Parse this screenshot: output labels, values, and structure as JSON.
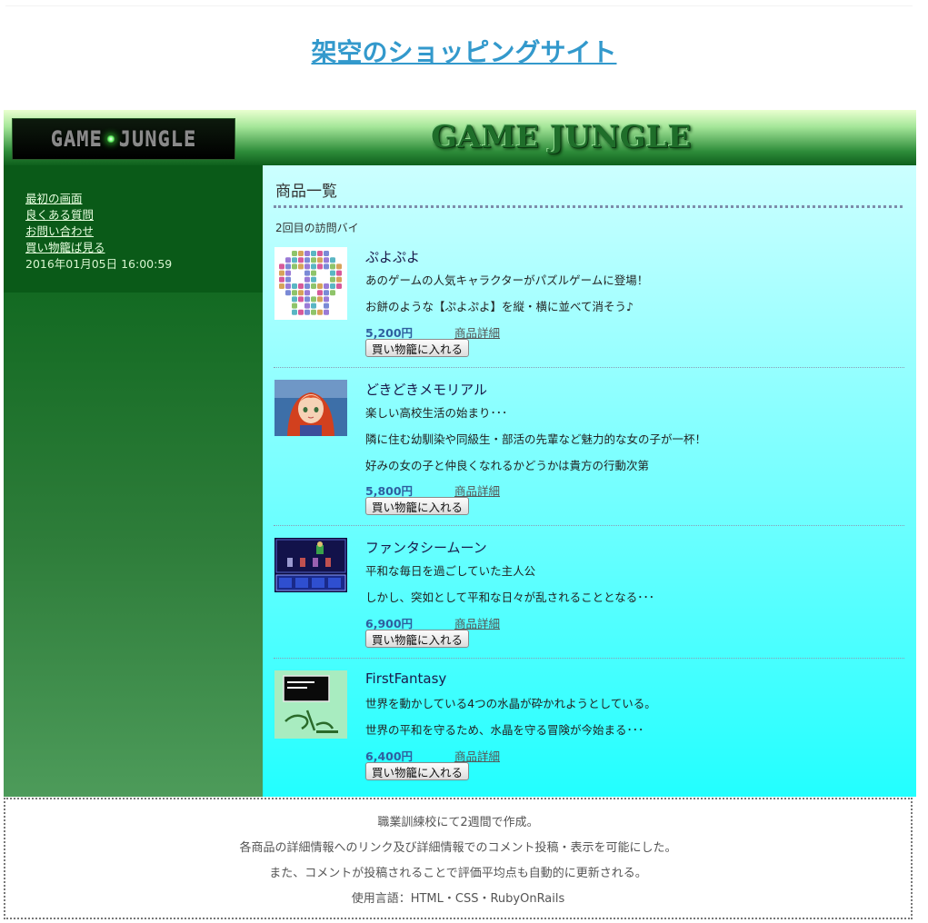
{
  "site_title": "架空のショッピングサイト",
  "header": {
    "logo_text": "GAME",
    "logo_text2": "JUNGLE",
    "banner_title": "GAME JUNGLE"
  },
  "sidebar": {
    "links": [
      "最初の画面",
      "良くある質問",
      "お問い合わせ",
      "買い物籠ば見る"
    ],
    "timestamp": "2016年01月05日 16:00:59"
  },
  "main": {
    "title": "商品一覧",
    "visit_text": "2回目の訪問バイ",
    "detail_label": "商品詳細",
    "cart_button_label": "買い物籠に入れる",
    "products": [
      {
        "name": "ぷよぷよ",
        "thumb_icon": "skull-puzzle-thumbnail",
        "description": [
          "あのゲームの人気キャラクターがパズルゲームに登場！",
          "お餅のような【ぷよぷよ】を縦・横に並べて消そう♪"
        ],
        "price": "5,200円"
      },
      {
        "name": "どきどきメモリアル",
        "thumb_icon": "anime-girl-thumbnail",
        "description": [
          "楽しい高校生活の始まり･･･",
          "隣に住む幼馴染や同級生・部活の先輩など魅力的な女の子が一杯！",
          "好みの女の子と仲良くなれるかどうかは貴方の行動次第"
        ],
        "price": "5,800円"
      },
      {
        "name": "ファンタシームーン",
        "thumb_icon": "rpg-battle-thumbnail",
        "description": [
          "平和な毎日を過ごしていた主人公",
          "しかし、突如として平和な日々が乱されることとなる･･･"
        ],
        "price": "6,900円"
      },
      {
        "name": "FirstFantasy",
        "thumb_icon": "title-screen-thumbnail",
        "description": [
          "世界を動かしている4つの水晶が砕かれようとしている。",
          "世界の平和を守るため、水晶を守る冒険が今始まる･･･"
        ],
        "price": "6,400円"
      }
    ]
  },
  "footer": {
    "lines": [
      "職業訓練校にて2週間で作成。",
      "各商品の詳細情報へのリンク及び詳細情報でのコメント投稿・表示を可能にした。",
      "また、コメントが投稿されることで評価平均点も自動的に更新される。",
      "使用言語：HTML・CSS・RubyOnRails"
    ]
  }
}
